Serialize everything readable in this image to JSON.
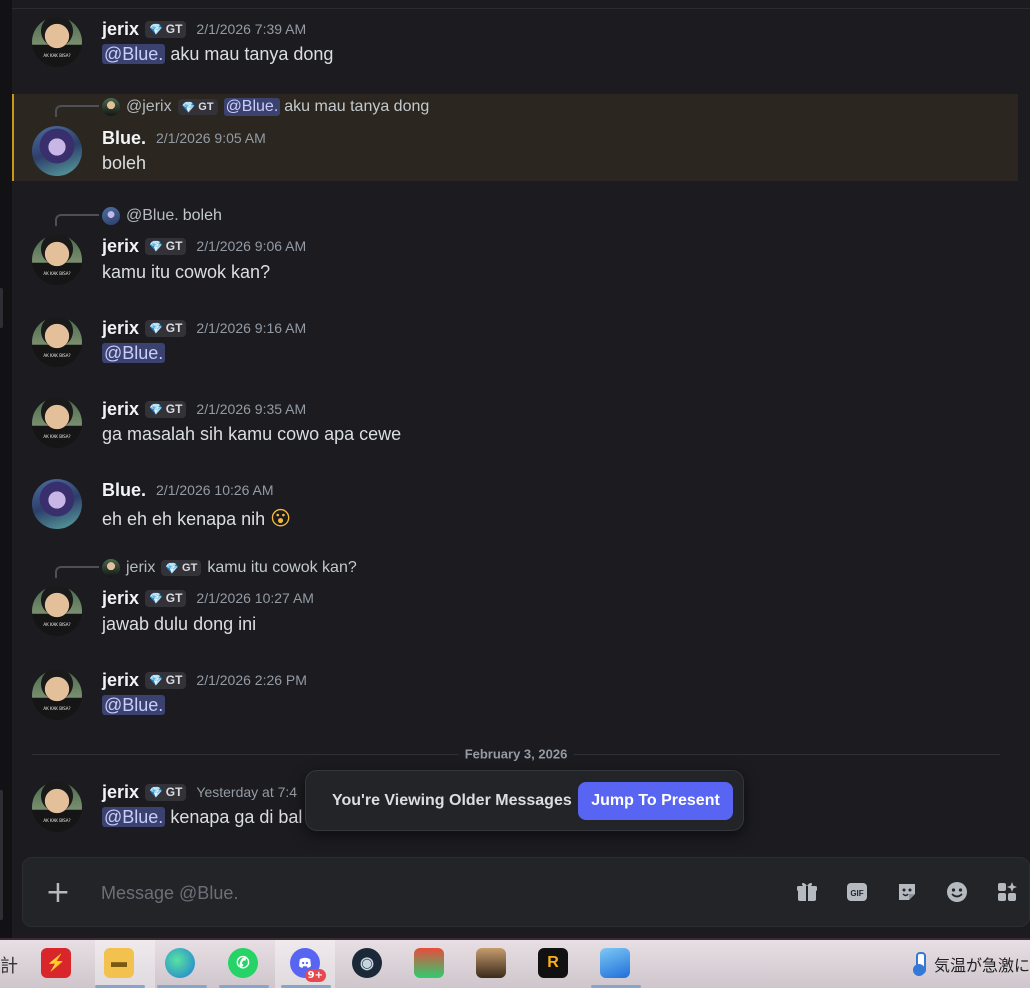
{
  "tags": {
    "server_tag": "GT"
  },
  "messages": [
    {
      "author": "jerix",
      "timestamp": "2/1/2026 7:39 AM",
      "mention": "@Blue.",
      "text": " aku mau tanya dong"
    },
    {
      "reply": {
        "author": "@jerix",
        "mention": "@Blue.",
        "text": " aku mau tanya dong"
      },
      "author": "Blue.",
      "timestamp": "2/1/2026 9:05 AM",
      "text": "boleh"
    },
    {
      "reply": {
        "author": "@Blue.",
        "text": "boleh"
      },
      "author": "jerix",
      "timestamp": "2/1/2026 9:06 AM",
      "text": "kamu itu cowok kan?"
    },
    {
      "author": "jerix",
      "timestamp": "2/1/2026 9:16 AM",
      "mention": "@Blue."
    },
    {
      "author": "jerix",
      "timestamp": "2/1/2026 9:35 AM",
      "text": "ga masalah sih kamu cowo apa cewe"
    },
    {
      "author": "Blue.",
      "timestamp": "2/1/2026 10:26 AM",
      "text": "eh eh eh kenapa nih",
      "emoji": "😮"
    },
    {
      "reply": {
        "author": "jerix",
        "text": "kamu itu cowok kan?"
      },
      "author": "jerix",
      "timestamp": "2/1/2026 10:27 AM",
      "text": "jawab dulu dong ini"
    },
    {
      "author": "jerix",
      "timestamp": "2/1/2026 2:26 PM",
      "mention": "@Blue."
    },
    {
      "author": "jerix",
      "timestamp": "Yesterday at 7:4",
      "mention": "@Blue.",
      "text": " kenapa ga di bal"
    }
  ],
  "date_divider": "February 3, 2026",
  "older_banner": {
    "label": "You're Viewing Older Messages",
    "button": "Jump To Present"
  },
  "composer": {
    "placeholder": "Message @Blue."
  },
  "taskbar": {
    "left_char": "計",
    "discord_badge": "9+",
    "weather_text": "気温が急激に",
    "apps": [
      "red-app-icon",
      "file-explorer-icon",
      "edge-icon",
      "whatsapp-icon",
      "discord-icon",
      "steam-icon",
      "game-icon",
      "avatar-game-icon",
      "rockstar-icon",
      "photos-icon"
    ]
  },
  "colors": {
    "accent": "#5865f2",
    "mention_bg": "#3c4270",
    "highlight_bar": "#c8961a",
    "background": "#1b1b20"
  }
}
